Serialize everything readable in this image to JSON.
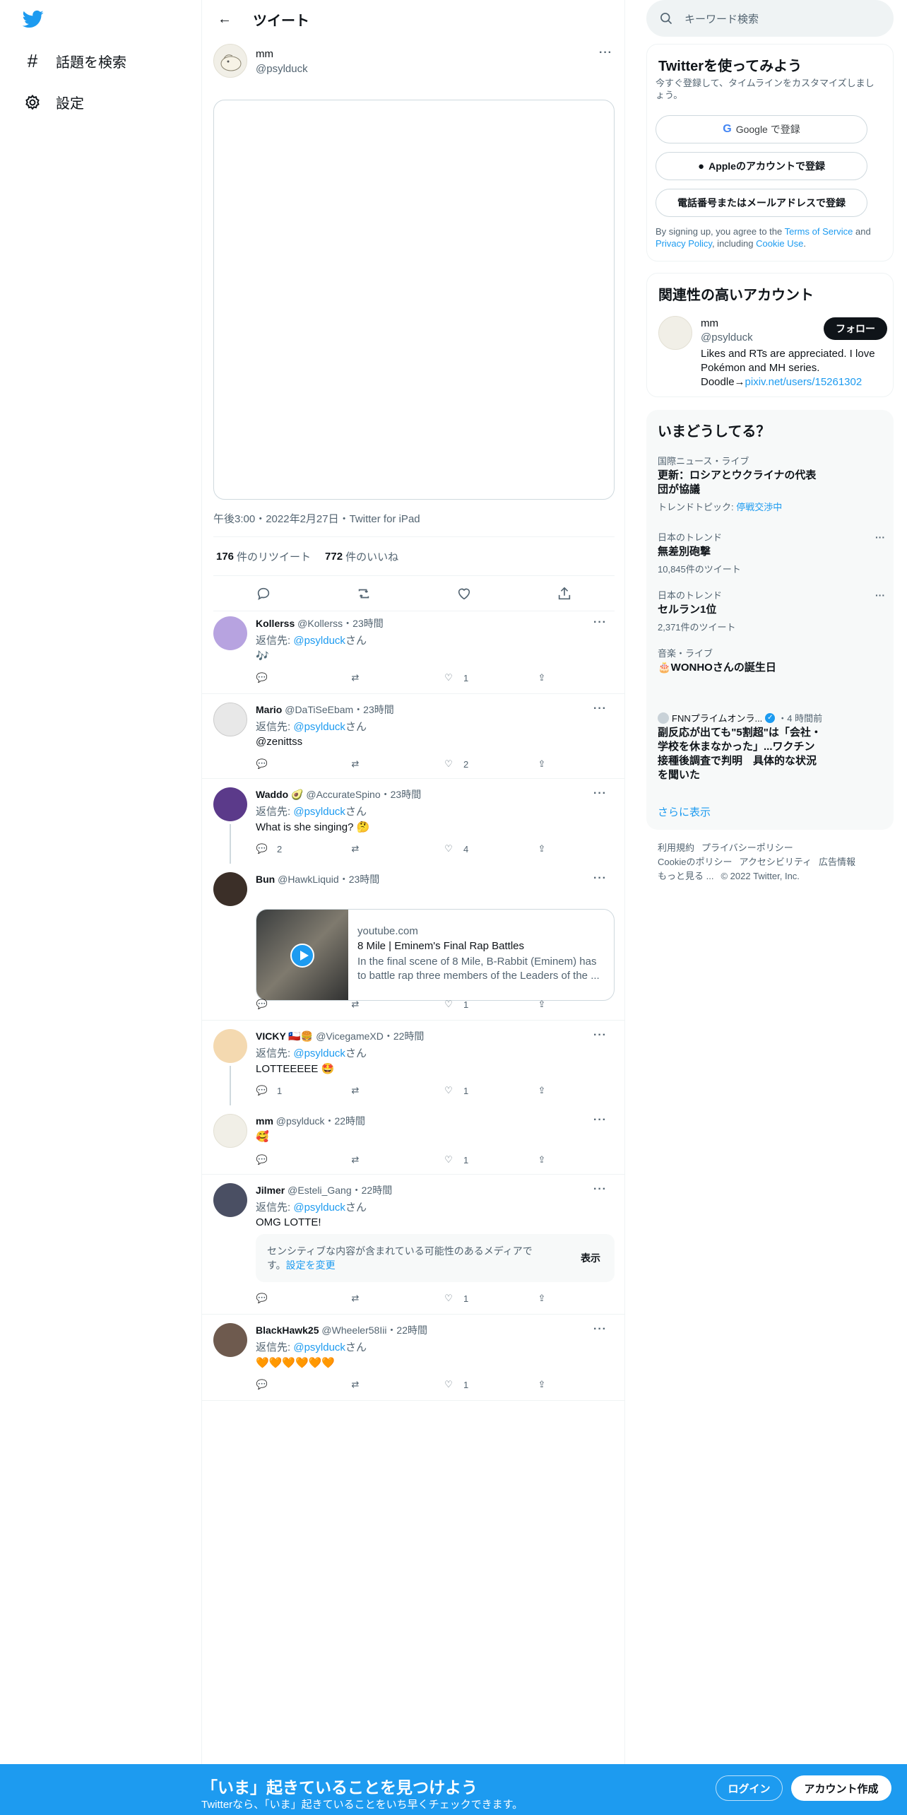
{
  "nav": {
    "explore_label": "話題を検索",
    "settings_label": "設定"
  },
  "header": {
    "title": "ツイート"
  },
  "main_tweet": {
    "name": "mm",
    "handle": "@psylduck",
    "meta": "午後3:00・2022年2月27日・Twitter for iPad",
    "retweets_count": "176",
    "retweets_label": "件のリツイート",
    "likes_count": "772",
    "likes_label": "件のいいね"
  },
  "replies": [
    {
      "name": "Kollerss",
      "handle": "@Kollerss",
      "time": "・23時間",
      "reply_prefix": "返信先: ",
      "reply_to": "@psylduck",
      "reply_suffix": "さん",
      "text": "🎶",
      "replies": "",
      "retweets": "",
      "likes": "1"
    },
    {
      "name": "Mario",
      "handle": "@DaTiSeEbam",
      "time": "・23時間",
      "reply_prefix": "返信先: ",
      "reply_to": "@psylduck",
      "reply_suffix": "さん",
      "text": "@zenittss",
      "replies": "",
      "retweets": "",
      "likes": "2"
    },
    {
      "name": "Waddo 🥑",
      "handle": "@AccurateSpino",
      "time": "・23時間",
      "reply_prefix": "返信先: ",
      "reply_to": "@psylduck",
      "reply_suffix": "さん",
      "text": "What is she singing? 🤔",
      "replies": "2",
      "retweets": "",
      "likes": "4"
    },
    {
      "name": "Bun",
      "handle": "@HawkLiquid",
      "time": "・23時間",
      "replies": "",
      "retweets": "",
      "likes": "1",
      "card": {
        "domain": "youtube.com",
        "title": "8 Mile | Eminem's Final Rap Battles",
        "desc": "In the final scene of 8 Mile, B-Rabbit (Eminem) has to battle rap three members of the Leaders of the ..."
      }
    },
    {
      "name": "VICKY 🇨🇱🍔",
      "handle": "@VicegameXD",
      "time": "・22時間",
      "reply_prefix": "返信先: ",
      "reply_to": "@psylduck",
      "reply_suffix": "さん",
      "text": "LOTTEEEEE 🤩",
      "replies": "1",
      "retweets": "",
      "likes": "1"
    },
    {
      "name": "mm",
      "handle": "@psylduck",
      "time": "・22時間",
      "text": "🥰",
      "replies": "",
      "retweets": "",
      "likes": "1"
    },
    {
      "name": "Jilmer",
      "handle": "@Esteli_Gang",
      "time": "・22時間",
      "reply_prefix": "返信先: ",
      "reply_to": "@psylduck",
      "reply_suffix": "さん",
      "text": "OMG LOTTE!",
      "replies": "",
      "retweets": "",
      "likes": "1",
      "sensitive": {
        "text": "センシティブな内容が含まれている可能性のあるメディアです。",
        "link": "設定を変更",
        "button": "表示"
      }
    },
    {
      "name": "BlackHawk25",
      "handle": "@Wheeler58Iii",
      "time": "・22時間",
      "reply_prefix": "返信先: ",
      "reply_to": "@psylduck",
      "reply_suffix": "さん",
      "text": "🧡🧡🧡🧡🧡🧡",
      "replies": "",
      "retweets": "",
      "likes": "1"
    }
  ],
  "search": {
    "placeholder": "キーワード検索"
  },
  "signup": {
    "title": "Twitterを使ってみよう",
    "subtitle": "今すぐ登録して、タイムラインをカスタマイズしましょう。",
    "google_btn": "Google で登録",
    "apple_btn": "Appleのアカウントで登録",
    "phone_btn": "電話番号またはメールアドレスで登録",
    "terms_1": "By signing up, you agree to the ",
    "terms_link1": "Terms of Service",
    "terms_2": " and ",
    "terms_link2": "Privacy Policy",
    "terms_3": ", including ",
    "terms_link3": "Cookie Use",
    "terms_4": "."
  },
  "relevant": {
    "title": "関連性の高いアカウント",
    "name": "mm",
    "handle": "@psylduck",
    "follow_btn": "フォロー",
    "bio": "Likes and RTs are appreciated. I love Pokémon and MH series. Doodle→",
    "bio_link": "pixiv.net/users/15261302"
  },
  "trends": {
    "title": "いまどうしてる？",
    "items": [
      {
        "category": "国際ニュース・ライブ",
        "title": "更新：ロシアとウクライナの代表団が協議",
        "sub_prefix": "トレンドトピック: ",
        "sub_link": "停戦交渉中"
      },
      {
        "category": "日本のトレンド",
        "title": "無差別砲撃",
        "sub": "10,845件のツイート"
      },
      {
        "category": "日本のトレンド",
        "title": "セルラン1位",
        "sub": "2,371件のツイート"
      },
      {
        "category": "音楽・ライブ",
        "title": "🎂WONHOさんの誕生日"
      }
    ],
    "news": {
      "source": "FNNプライムオンラ...",
      "ago": "・4 時間前",
      "headline": "副反応が出ても\"5割超\"は「会社・学校を休まなかった」...ワクチン接種後調査で判明　具体的な状況を聞いた"
    },
    "show_more": "さらに表示"
  },
  "footer": {
    "terms": "利用規約",
    "privacy": "プライバシーポリシー",
    "cookie": "Cookieのポリシー",
    "accessibility": "アクセシビリティ",
    "ads": "広告情報",
    "more": "もっと見る ...",
    "copyright": "© 2022 Twitter, Inc."
  },
  "bottom_bar": {
    "title": "「いま」起きていることを見つけよう",
    "subtitle": "Twitterなら、「いま」起きていることをいち早くチェックできます。",
    "login": "ログイン",
    "signup": "アカウント作成"
  },
  "colors": {
    "accent": "#1d9bf0",
    "text": "#0f1419",
    "muted": "#536471"
  }
}
